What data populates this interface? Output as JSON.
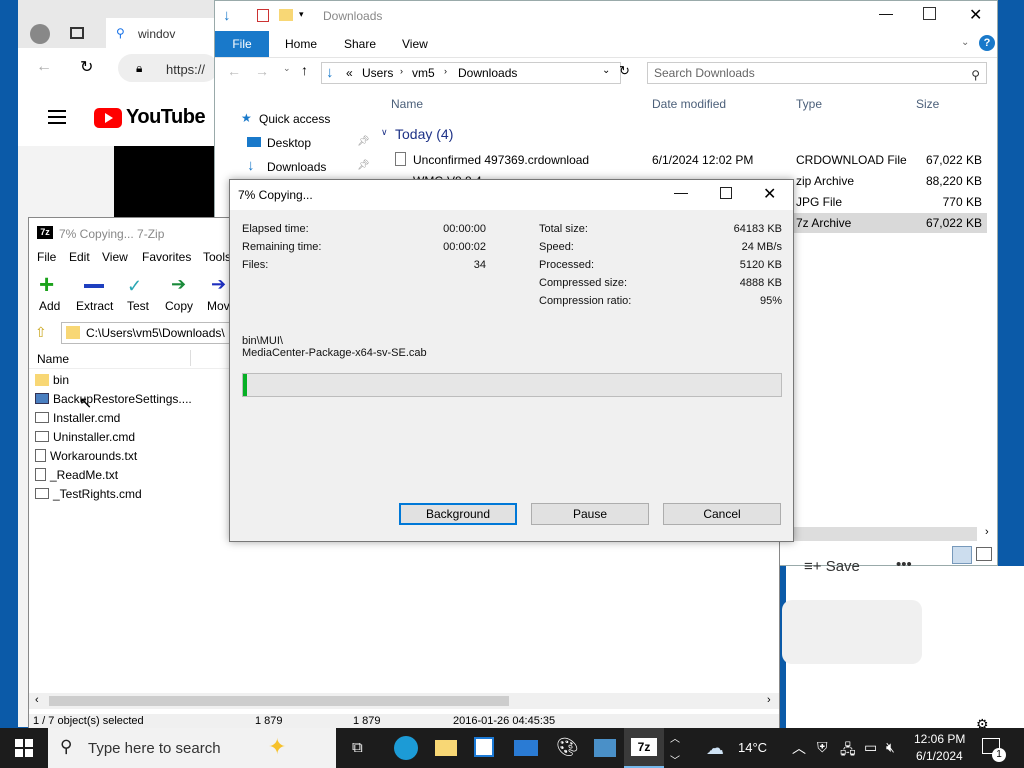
{
  "browser": {
    "tab_label": "windov",
    "url": "https://",
    "site_logo": "YouTube"
  },
  "explorer": {
    "title": "Downloads",
    "ribbon_tabs": [
      "File",
      "Home",
      "Share",
      "View"
    ],
    "path": [
      "«",
      "Users",
      "vm5",
      "Downloads"
    ],
    "search_placeholder": "Search Downloads",
    "columns": [
      "Name",
      "Date modified",
      "Type",
      "Size"
    ],
    "nav": [
      "Quick access",
      "Desktop",
      "Downloads"
    ],
    "group": "Today (4)",
    "files": [
      {
        "name": "Unconfirmed 497369.crdownload",
        "date": "6/1/2024 12:02 PM",
        "type": "CRDOWNLOAD File",
        "size": "67,022 KB"
      },
      {
        "name": "WMC-V8.8.4...",
        "date": "",
        "type": "zip Archive",
        "size": "88,220 KB"
      },
      {
        "name": "",
        "date": "",
        "type": "JPG File",
        "size": "770 KB"
      },
      {
        "name": "",
        "date": "",
        "type": "7z Archive",
        "size": "67,022 KB"
      }
    ]
  },
  "sevenzip": {
    "title": "7% Copying... 7-Zip",
    "menu": [
      "File",
      "Edit",
      "View",
      "Favorites",
      "Tools"
    ],
    "toolbar": [
      "Add",
      "Extract",
      "Test",
      "Copy",
      "Mov"
    ],
    "path": "C:\\Users\\vm5\\Downloads\\",
    "col_name": "Name",
    "items": [
      {
        "name": "bin",
        "icon": "folder-icon"
      },
      {
        "name": "BackupRestoreSettings....",
        "icon": "image-icon"
      },
      {
        "name": "Installer.cmd",
        "icon": "cmd-icon"
      },
      {
        "name": "Uninstaller.cmd",
        "icon": "cmd-icon"
      },
      {
        "name": "Workarounds.txt",
        "icon": "text-icon"
      },
      {
        "name": "_ReadMe.txt",
        "icon": "text-icon"
      },
      {
        "name": "_TestRights.cmd",
        "icon": "cmd-icon"
      }
    ],
    "status": [
      "1 / 7 object(s) selected",
      "1 879",
      "1 879",
      "2016-01-26 04:45:35"
    ]
  },
  "dialog": {
    "title": "7% Copying...",
    "left_labels": [
      "Elapsed time:",
      "Remaining time:",
      "Files:"
    ],
    "left_values": [
      "00:00:00",
      "00:00:02",
      "34"
    ],
    "right_labels": [
      "Total size:",
      "Speed:",
      "Processed:",
      "Compressed size:",
      "Compression ratio:"
    ],
    "right_values": [
      "64183 KB",
      "24 MB/s",
      "5120 KB",
      "4888 KB",
      "95%"
    ],
    "current_path": "bin\\MUI\\",
    "current_file": "MediaCenter-Package-x64-sv-SE.cab",
    "progress": 0.007,
    "buttons": {
      "background": "Background",
      "pause": "Pause",
      "cancel": "Cancel"
    }
  },
  "explorer_bottom": {
    "save_label": "Save"
  },
  "taskbar": {
    "search_placeholder": "Type here to search",
    "weather": "14°C",
    "time": "12:06 PM",
    "date": "6/1/2024",
    "notification_count": "1"
  },
  "colors": {
    "accent": "#1979ca",
    "progress": "#06b025",
    "taskbar": "#1c1c1c"
  }
}
